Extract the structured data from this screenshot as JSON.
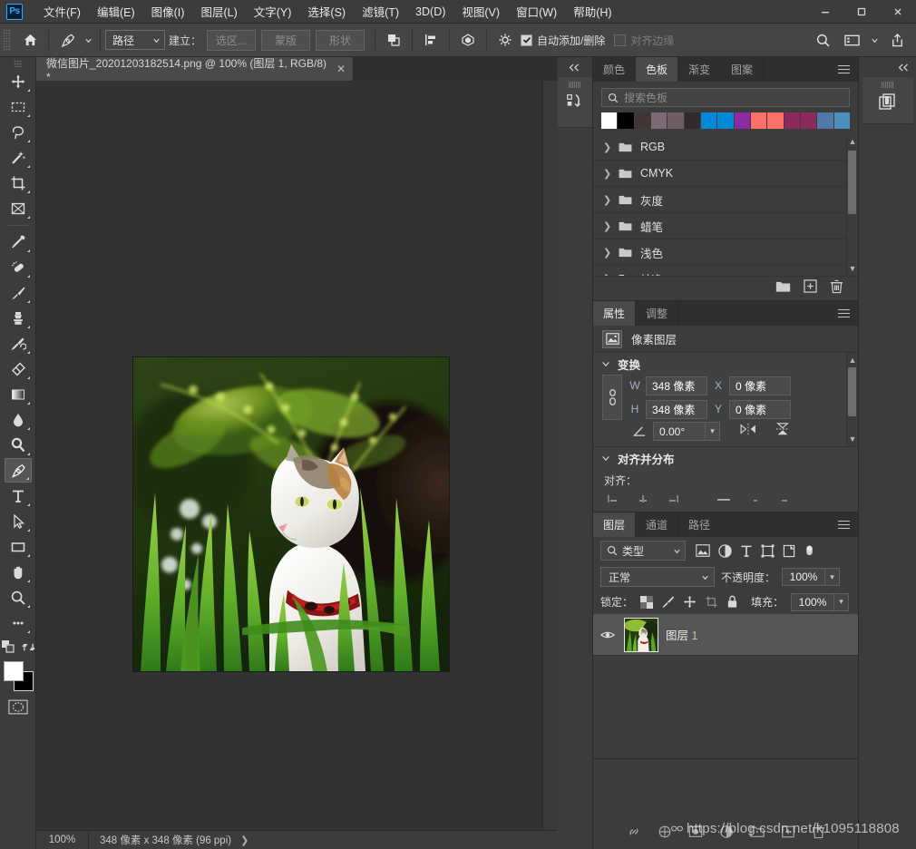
{
  "app": {
    "logo_text": "Ps",
    "window_controls": [
      "minimize",
      "maximize",
      "close"
    ]
  },
  "menubar": {
    "items": [
      {
        "label": "文件(F)"
      },
      {
        "label": "编辑(E)"
      },
      {
        "label": "图像(I)"
      },
      {
        "label": "图层(L)"
      },
      {
        "label": "文字(Y)"
      },
      {
        "label": "选择(S)"
      },
      {
        "label": "滤镜(T)"
      },
      {
        "label": "3D(D)"
      },
      {
        "label": "视图(V)"
      },
      {
        "label": "窗口(W)"
      },
      {
        "label": "帮助(H)"
      }
    ]
  },
  "options_bar": {
    "tool_icon": "pen-tool-icon",
    "mode_select": "路径",
    "make_label": "建立：",
    "selection_button": "选区...",
    "mask_button": "蒙版",
    "shape_button": "形状",
    "auto_add_delete_label": "自动添加/删除",
    "align_edges_label": "对齐边缘",
    "right_icons": [
      "search-icon",
      "workspace-icon",
      "share-icon"
    ]
  },
  "toolbar": {
    "tools": [
      {
        "name": "move-tool",
        "active": false
      },
      {
        "name": "marquee-tool",
        "active": false
      },
      {
        "name": "lasso-tool",
        "active": false
      },
      {
        "name": "magic-wand-tool",
        "active": false
      },
      {
        "name": "crop-tool",
        "active": false
      },
      {
        "name": "frame-tool",
        "active": false
      },
      {
        "name": "eyedropper-tool",
        "active": false
      },
      {
        "name": "healing-brush-tool",
        "active": false
      },
      {
        "name": "brush-tool",
        "active": false
      },
      {
        "name": "clone-stamp-tool",
        "active": false
      },
      {
        "name": "history-brush-tool",
        "active": false
      },
      {
        "name": "eraser-tool",
        "active": false
      },
      {
        "name": "gradient-tool",
        "active": false
      },
      {
        "name": "blur-tool",
        "active": false
      },
      {
        "name": "dodge-tool",
        "active": false
      },
      {
        "name": "pen-tool",
        "active": true
      },
      {
        "name": "type-tool",
        "active": false
      },
      {
        "name": "path-selection-tool",
        "active": false
      },
      {
        "name": "rectangle-tool",
        "active": false
      },
      {
        "name": "hand-tool",
        "active": false
      },
      {
        "name": "zoom-tool",
        "active": false
      },
      {
        "name": "edit-toolbar",
        "active": false
      }
    ],
    "foreground_color": "#ffffff",
    "background_color": "#000000"
  },
  "document": {
    "tab_title": "微信图片_20201203182514.png @ 100% (图层 1, RGB/8) *",
    "close_glyph": "✕"
  },
  "status_bar": {
    "zoom": "100%",
    "doc_info": "348 像素 x 348 像素 (96 ppi)",
    "arrow": "❯"
  },
  "swatches_panel": {
    "tabs": [
      {
        "label": "颜色",
        "active": false
      },
      {
        "label": "色板",
        "active": true
      },
      {
        "label": "渐变",
        "active": false
      },
      {
        "label": "图案",
        "active": false
      }
    ],
    "search_placeholder": "搜索色板",
    "swatch_colors": [
      "#ffffff",
      "#000000",
      "#413536",
      "#7e6a77",
      "#6e5d65",
      "#332a30",
      "#0089d8",
      "#0089d8",
      "#8e2aa6",
      "#fc7068",
      "#fc7068",
      "#8c2a5f",
      "#8c2a5f",
      "#5378a8",
      "#4a8fbe"
    ],
    "groups": [
      {
        "label": "RGB"
      },
      {
        "label": "CMYK"
      },
      {
        "label": "灰度"
      },
      {
        "label": "蜡笔"
      },
      {
        "label": "浅色"
      },
      {
        "label": "纯净"
      }
    ],
    "footer_icons": [
      "new-group-icon",
      "new-swatch-icon",
      "delete-icon"
    ]
  },
  "properties_panel": {
    "tabs": [
      {
        "label": "属性",
        "active": true
      },
      {
        "label": "调整",
        "active": false
      }
    ],
    "layer_kind": "像素图层",
    "transform": {
      "section_title": "变换",
      "w_label": "W",
      "w_value": "348 像素",
      "x_label": "X",
      "x_value": "0 像素",
      "h_label": "H",
      "h_value": "348 像素",
      "y_label": "Y",
      "y_value": "0 像素",
      "angle_value": "0.00°",
      "link_icon": "link-icon",
      "flip_h_icon": "flip-horizontal-icon",
      "flip_v_icon": "flip-vertical-icon"
    },
    "align": {
      "section_title": "对齐并分布",
      "align_label": "对齐："
    }
  },
  "layers_panel": {
    "tabs": [
      {
        "label": "图层",
        "active": true
      },
      {
        "label": "通道",
        "active": false
      },
      {
        "label": "路径",
        "active": false
      }
    ],
    "filter_label": "类型",
    "filter_icons": [
      "image-filter-icon",
      "adjustment-filter-icon",
      "type-filter-icon",
      "shape-filter-icon",
      "smart-object-filter-icon",
      "filter-toggle-icon"
    ],
    "blend_mode": "正常",
    "opacity_label": "不透明度：",
    "opacity_value": "100%",
    "lock_label": "锁定：",
    "lock_icons": [
      "lock-transparent-icon",
      "lock-image-icon",
      "lock-position-icon",
      "lock-artboard-icon",
      "lock-all-icon"
    ],
    "fill_label": "填充：",
    "fill_value": "100%",
    "layers": [
      {
        "name": "图层",
        "index": "1",
        "visible": true,
        "selected": true
      }
    ]
  },
  "docks": {
    "left_collapsed_icon": "history-panel-icon",
    "right_collapsed_icon": "libraries-panel-icon",
    "collapse_glyph": "❮❮"
  },
  "watermark": {
    "text": "https://blog.csdn.net/k1095118808",
    "link_icon": "link-chain-icon"
  }
}
